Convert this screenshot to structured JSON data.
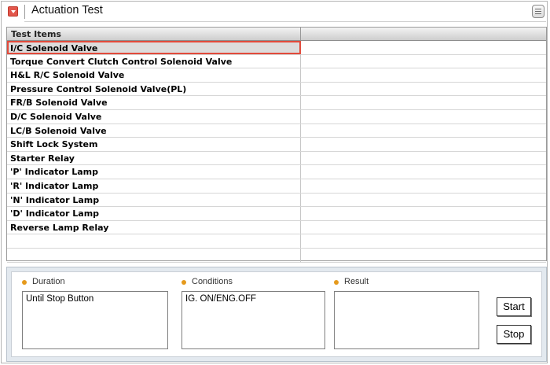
{
  "window": {
    "title": "Actuation Test"
  },
  "table": {
    "header": [
      "Test Items",
      ""
    ],
    "selected_index": 0,
    "items": [
      "I/C Solenoid Valve",
      "Torque Convert Clutch Control Solenoid Valve",
      "H&L R/C Solenoid Valve",
      "Pressure Control Solenoid Valve(PL)",
      "FR/B Solenoid Valve",
      "D/C Solenoid Valve",
      "LC/B Solenoid Valve",
      "Shift Lock System",
      "Starter Relay",
      "'P' Indicator Lamp",
      "'R' Indicator Lamp",
      "'N' Indicator Lamp",
      "'D' Indicator Lamp",
      "Reverse Lamp Relay"
    ],
    "empty_rows": 2
  },
  "panel": {
    "duration_label": "Duration",
    "duration_value": "Until Stop Button",
    "conditions_label": "Conditions",
    "conditions_value": "IG. ON/ENG.OFF",
    "result_label": "Result",
    "result_value": "",
    "start_label": "Start",
    "stop_label": "Stop"
  },
  "colors": {
    "selection_border": "#e24a3b",
    "bullet": "#e59a1c",
    "panel_background": "#e3e9ef"
  },
  "icons": [
    "collapse-arrow-icon",
    "menu-icon",
    "bullet-icon"
  ]
}
